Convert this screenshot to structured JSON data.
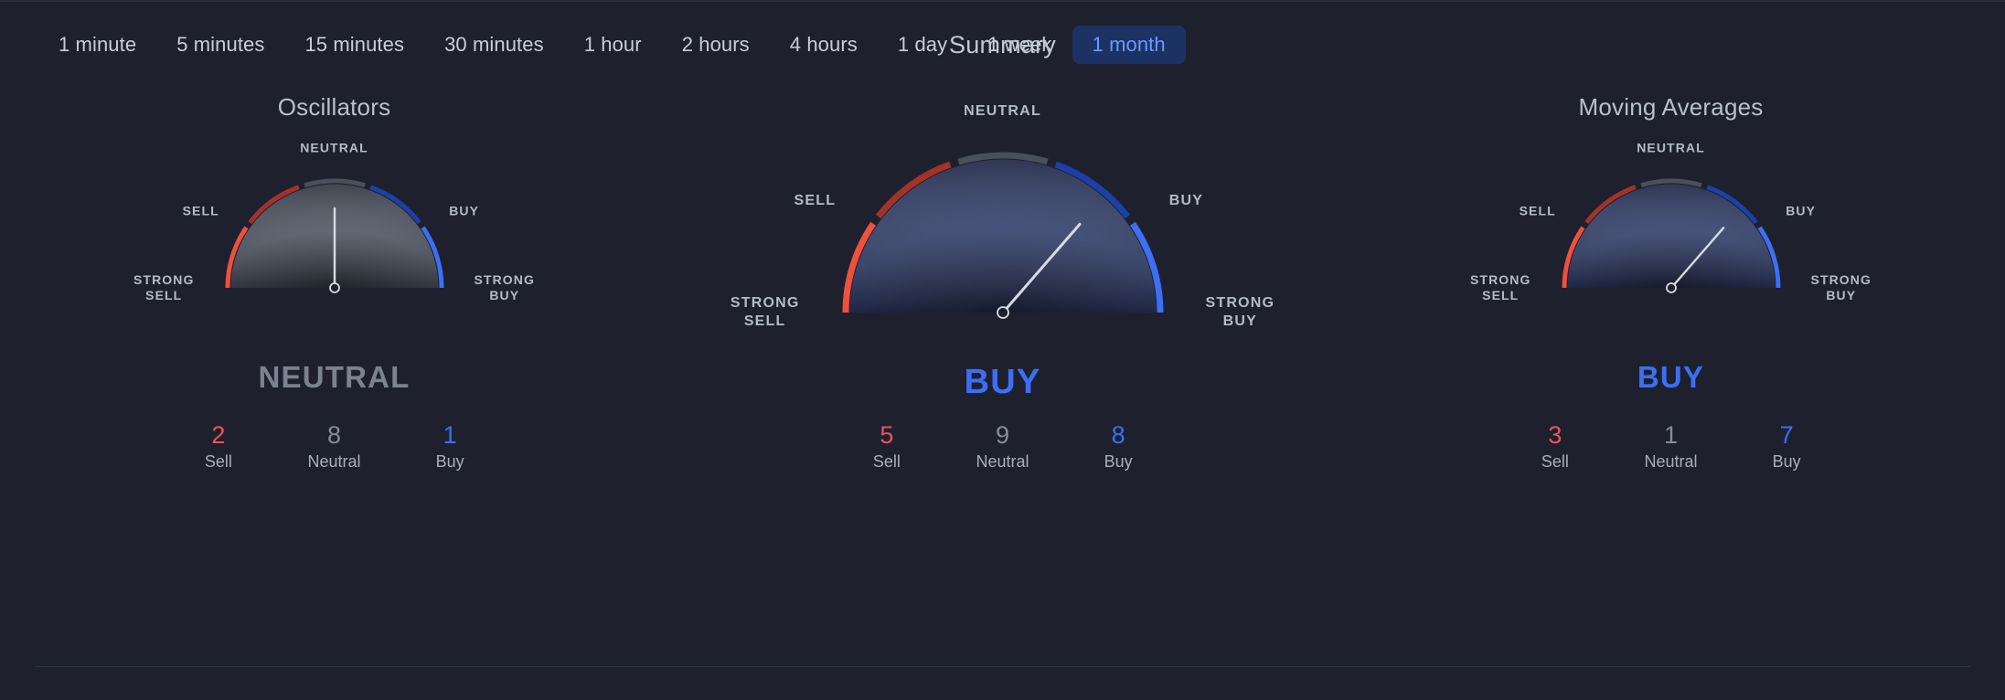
{
  "timeframes": {
    "items": [
      {
        "label": "1 minute",
        "active": false
      },
      {
        "label": "5 minutes",
        "active": false
      },
      {
        "label": "15 minutes",
        "active": false
      },
      {
        "label": "30 minutes",
        "active": false
      },
      {
        "label": "1 hour",
        "active": false
      },
      {
        "label": "2 hours",
        "active": false
      },
      {
        "label": "4 hours",
        "active": false
      },
      {
        "label": "1 day",
        "active": false
      },
      {
        "label": "1 week",
        "active": false
      },
      {
        "label": "1 month",
        "active": true
      }
    ]
  },
  "summary_title": "Summary",
  "scale_labels": {
    "strong_sell": "STRONG\nSELL",
    "sell": "SELL",
    "neutral": "NEUTRAL",
    "buy": "BUY",
    "strong_buy": "STRONG\nBUY"
  },
  "count_labels": {
    "sell": "Sell",
    "neutral": "Neutral",
    "buy": "Buy"
  },
  "colors": {
    "background": "#1e212d",
    "strong_sell": "#f0503c",
    "sell": "#a33229",
    "neutral": "#4a4f5c",
    "buy": "#1c3fa8",
    "strong_buy": "#3c6ff5",
    "fill_buy": "#2b3761",
    "fill_neutral": "#4c515d",
    "needle": "#d6dae2",
    "verdict_buy": "#3c6ff5",
    "verdict_neutral": "#7c828f",
    "tab_active_bg": "#1b3263",
    "tab_active_text": "#6b9aff"
  },
  "chart_data": {
    "type": "gauge",
    "title": "Summary",
    "scale": [
      "STRONG SELL",
      "SELL",
      "NEUTRAL",
      "BUY",
      "STRONG BUY"
    ],
    "timeframe": "1 month",
    "gauges": [
      {
        "name": "oscillators",
        "title": "Oscillators",
        "verdict": "NEUTRAL",
        "verdict_color": "#7c828f",
        "needle_angle_deg": 0,
        "counts": {
          "sell": 2,
          "neutral": 8,
          "buy": 1
        }
      },
      {
        "name": "summary",
        "title": "Summary",
        "verdict": "BUY",
        "verdict_color": "#3c6ff5",
        "needle_angle_deg": 41,
        "counts": {
          "sell": 5,
          "neutral": 9,
          "buy": 8
        }
      },
      {
        "name": "moving-averages",
        "title": "Moving Averages",
        "verdict": "BUY",
        "verdict_color": "#3c6ff5",
        "needle_angle_deg": 41,
        "counts": {
          "sell": 3,
          "neutral": 1,
          "buy": 7
        }
      }
    ]
  }
}
